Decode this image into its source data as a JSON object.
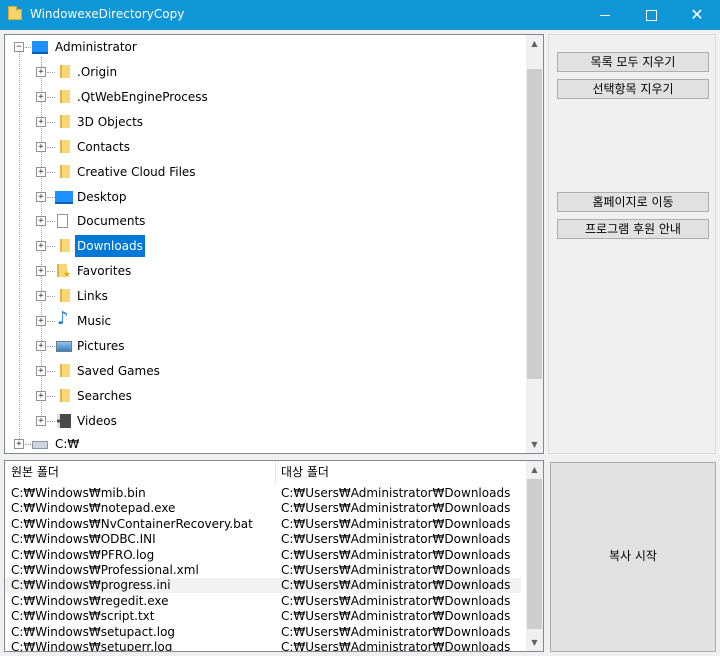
{
  "window": {
    "title": "WindowexeDirectoryCopy",
    "controls": {
      "minimize": "—",
      "maximize": "☐",
      "close": "✕"
    },
    "accent": "#0f96d6"
  },
  "tree": {
    "root": {
      "label": "Administrator",
      "icon": "user-folder-icon"
    },
    "children": [
      {
        "label": ".Origin",
        "icon": "folder-icon"
      },
      {
        "label": ".QtWebEngineProcess",
        "icon": "folder-icon"
      },
      {
        "label": "3D Objects",
        "icon": "folder-icon"
      },
      {
        "label": "Contacts",
        "icon": "folder-icon"
      },
      {
        "label": "Creative Cloud Files",
        "icon": "folder-icon"
      },
      {
        "label": "Desktop",
        "icon": "desktop-icon"
      },
      {
        "label": "Documents",
        "icon": "documents-icon"
      },
      {
        "label": "Downloads",
        "icon": "folder-icon",
        "selected": true
      },
      {
        "label": "Favorites",
        "icon": "favorites-icon"
      },
      {
        "label": "Links",
        "icon": "folder-icon"
      },
      {
        "label": "Music",
        "icon": "music-icon"
      },
      {
        "label": "Pictures",
        "icon": "pictures-icon"
      },
      {
        "label": "Saved Games",
        "icon": "folder-icon"
      },
      {
        "label": "Searches",
        "icon": "folder-icon"
      },
      {
        "label": "Videos",
        "icon": "videos-icon"
      }
    ],
    "drive": {
      "label": "C:\\",
      "display": "C:₩",
      "icon": "drive-icon"
    },
    "selected_color": "#0078d7"
  },
  "buttons": {
    "clear_all": "목록 모두 지우기",
    "clear_selected": "선택항목 지우기",
    "homepage": "홈페이지로 이동",
    "support": "프로그램 후원 안내",
    "start_copy": "복사 시작"
  },
  "list": {
    "headers": {
      "source": "원본 폴더",
      "target": "대상 폴더"
    },
    "rows": [
      {
        "source": "C:₩Windows₩mib.bin",
        "target": "C:₩Users₩Administrator₩Downloads"
      },
      {
        "source": "C:₩Windows₩notepad.exe",
        "target": "C:₩Users₩Administrator₩Downloads"
      },
      {
        "source": "C:₩Windows₩NvContainerRecovery.bat",
        "target": "C:₩Users₩Administrator₩Downloads"
      },
      {
        "source": "C:₩Windows₩ODBC.INI",
        "target": "C:₩Users₩Administrator₩Downloads"
      },
      {
        "source": "C:₩Windows₩PFRO.log",
        "target": "C:₩Users₩Administrator₩Downloads"
      },
      {
        "source": "C:₩Windows₩Professional.xml",
        "target": "C:₩Users₩Administrator₩Downloads"
      },
      {
        "source": "C:₩Windows₩progress.ini",
        "target": "C:₩Users₩Administrator₩Downloads",
        "highlighted": true
      },
      {
        "source": "C:₩Windows₩regedit.exe",
        "target": "C:₩Users₩Administrator₩Downloads"
      },
      {
        "source": "C:₩Windows₩script.txt",
        "target": "C:₩Users₩Administrator₩Downloads"
      },
      {
        "source": "C:₩Windows₩setupact.log",
        "target": "C:₩Users₩Administrator₩Downloads"
      },
      {
        "source": "C:₩Windows₩setuperr.log",
        "target": "C:₩Users₩Administrator₩Downloads"
      }
    ]
  }
}
